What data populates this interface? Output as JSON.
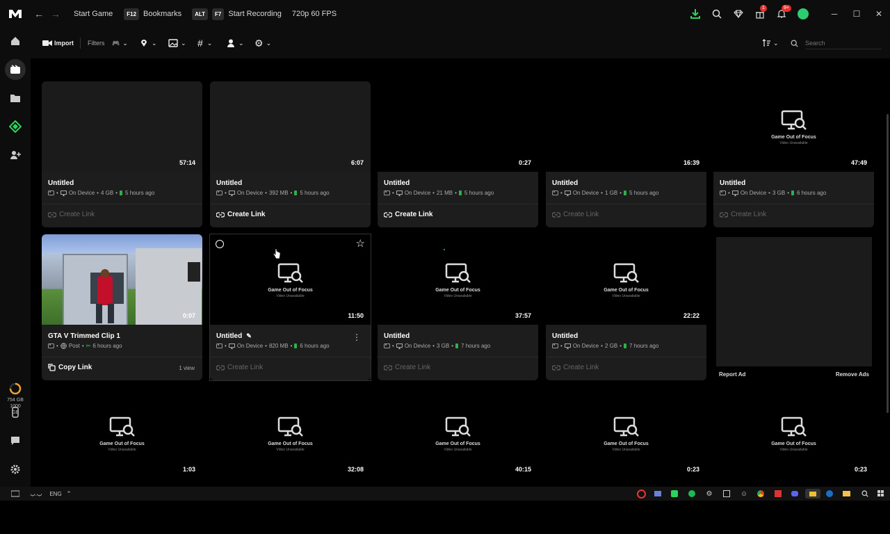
{
  "topbar": {
    "back": "←",
    "forward": "→",
    "start_game": "Start Game",
    "bookmarks_key": "F12",
    "bookmarks": "Bookmarks",
    "alt_key": "ALT",
    "f7_key": "F7",
    "start_recording": "Start Recording",
    "quality": "720p 60 FPS",
    "gift_badge": "1",
    "notif_badge": "9+",
    "minimize": "─",
    "maximize": "☐",
    "close": "✕"
  },
  "sidebar": {
    "storage_used": "754 GB",
    "storage_total": "1000",
    "storage_unit": "GB"
  },
  "toolbar": {
    "import": "Import",
    "filters": "Filters",
    "search_placeholder": "Search"
  },
  "clips": [
    {
      "title": "Untitled",
      "duration": "57:14",
      "location": "On Device",
      "size": "4 GB",
      "time": "5 hours ago",
      "link": "Create Link"
    },
    {
      "title": "Untitled",
      "duration": "6:07",
      "location": "On Device",
      "size": "392 MB",
      "time": "5 hours ago",
      "link": "Create Link"
    },
    {
      "title": "Untitled",
      "duration": "0:27",
      "location": "On Device",
      "size": "21 MB",
      "time": "5 hours ago",
      "link": "Create Link"
    },
    {
      "title": "Untitled",
      "duration": "16:39",
      "location": "On Device",
      "size": "1 GB",
      "time": "5 hours ago",
      "link": "Create Link"
    },
    {
      "title": "Untitled",
      "duration": "47:49",
      "location": "On Device",
      "size": "3 GB",
      "time": "6 hours ago",
      "link": "Create Link",
      "gof": "Game Out of Focus",
      "gof_sub": "Video Unavailable"
    },
    {
      "title": "GTA V Trimmed Clip 1",
      "duration": "0:07",
      "location": "Post",
      "time": "6 hours ago",
      "link": "Copy Link",
      "views": "1 view"
    },
    {
      "title": "Untitled",
      "duration": "11:50",
      "location": "On Device",
      "size": "820 MB",
      "time": "6 hours ago",
      "link": "Create Link",
      "gof": "Game Out of Focus",
      "gof_sub": "Video Unavailable"
    },
    {
      "title": "Untitled",
      "duration": "37:57",
      "location": "On Device",
      "size": "3 GB",
      "time": "7 hours ago",
      "link": "Create Link",
      "gof": "Game Out of Focus",
      "gof_sub": "Video Unavailable"
    },
    {
      "title": "Untitled",
      "duration": "22:22",
      "location": "On Device",
      "size": "2 GB",
      "time": "7 hours ago",
      "link": "Create Link",
      "gof": "Game Out of Focus",
      "gof_sub": "Video Unavailable"
    },
    {
      "duration": "1:03",
      "gof": "Game Out of Focus",
      "gof_sub": "Video Unavailable"
    },
    {
      "duration": "32:08",
      "gof": "Game Out of Focus",
      "gof_sub": "Video Unavailable"
    },
    {
      "duration": "40:15",
      "gof": "Game Out of Focus",
      "gof_sub": "Video Unavailable"
    },
    {
      "duration": "0:23",
      "gof": "Game Out of Focus",
      "gof_sub": "Video Unavailable"
    },
    {
      "duration": "0:23",
      "gof": "Game Out of Focus",
      "gof_sub": "Video Unavailable"
    }
  ],
  "ad": {
    "report": "Report Ad",
    "remove": "Remove Ads"
  },
  "taskbar": {
    "lang": "ENG",
    "ime": "ب.ب"
  }
}
